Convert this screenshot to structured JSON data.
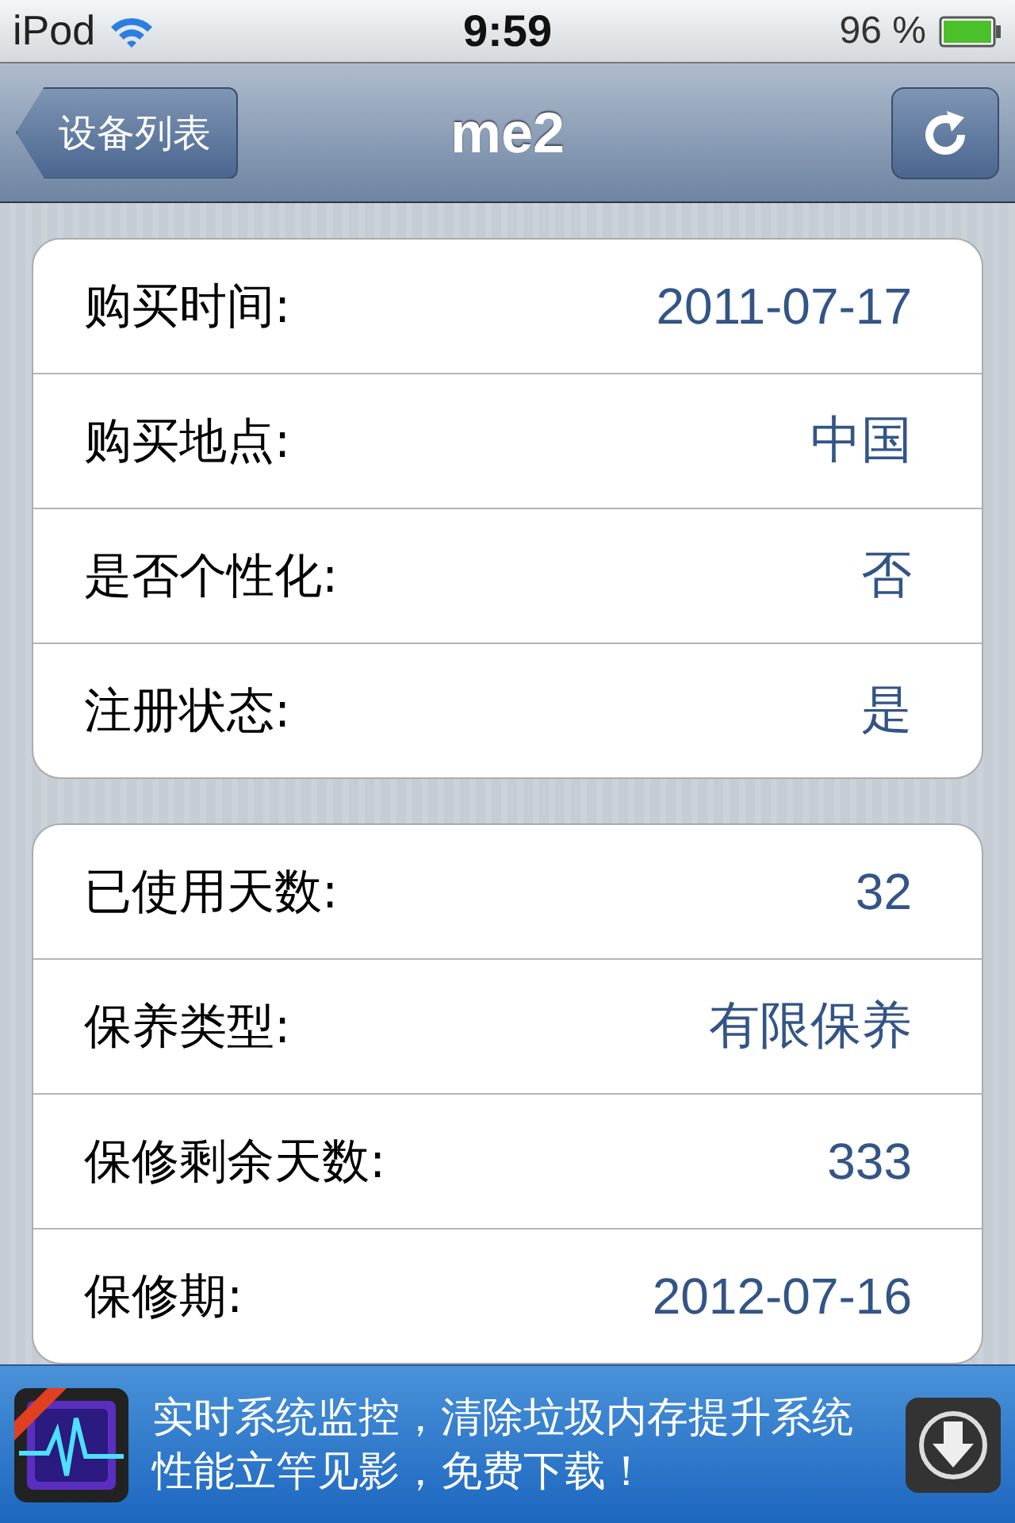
{
  "status_bar": {
    "carrier": "iPod",
    "time": "9:59",
    "battery_text": "96 %"
  },
  "nav_bar": {
    "back_button": "设备列表",
    "title": "me2"
  },
  "groups": [
    {
      "rows": [
        {
          "label": "购买时间:",
          "value": "2011-07-17"
        },
        {
          "label": "购买地点:",
          "value": "中国"
        },
        {
          "label": "是否个性化:",
          "value": "否"
        },
        {
          "label": "注册状态:",
          "value": "是"
        }
      ]
    },
    {
      "rows": [
        {
          "label": "已使用天数:",
          "value": "32"
        },
        {
          "label": "保养类型:",
          "value": "有限保养"
        },
        {
          "label": "保修剩余天数:",
          "value": "333"
        },
        {
          "label": "保修期:",
          "value": "2012-07-16"
        }
      ]
    }
  ],
  "ad_banner": {
    "text": "实时系统监控，清除垃圾内存提升系统性能立竿见影，免费下载！"
  }
}
